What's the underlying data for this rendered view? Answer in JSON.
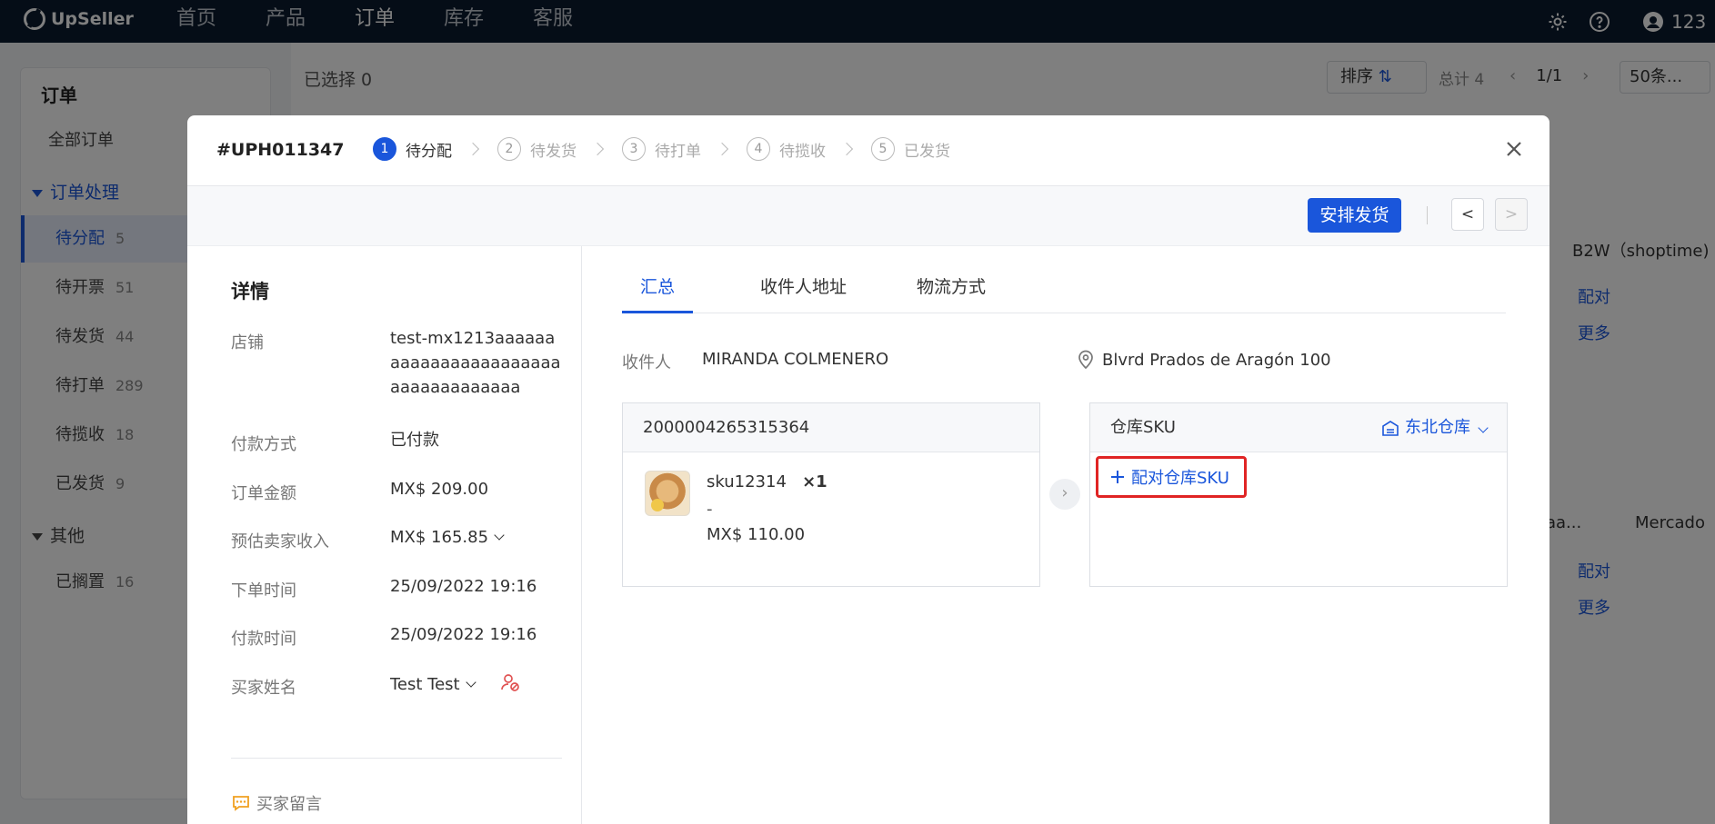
{
  "topbar": {
    "brand": "UpSeller",
    "nav": [
      "首页",
      "产品",
      "订单",
      "库存",
      "客服"
    ],
    "active_nav": "订单",
    "user": "123"
  },
  "sidebar": {
    "title": "订单",
    "all_orders": "全部订单",
    "group_processing": "订单处理",
    "items": [
      {
        "label": "待分配",
        "count": "5"
      },
      {
        "label": "待开票",
        "count": "51"
      },
      {
        "label": "待发货",
        "count": "44"
      },
      {
        "label": "待打单",
        "count": "289"
      },
      {
        "label": "待揽收",
        "count": "18"
      },
      {
        "label": "已发货",
        "count": "9"
      }
    ],
    "group_other": "其他",
    "other_items": [
      {
        "label": "已搁置",
        "count": "16"
      }
    ]
  },
  "list": {
    "selected": "已选择 0",
    "sort": "排序",
    "total": "总计 4",
    "page": "1/1",
    "per_page": "50条...",
    "col_platform": "B2W（shoptime)",
    "row1_pair": "配对",
    "row1_more": "更多",
    "row2_store": "aa...",
    "row2_platform": "Mercado",
    "row2_pair": "配对",
    "row2_more": "更多"
  },
  "modal": {
    "order_no": "#UPH011347",
    "steps": [
      {
        "num": "1",
        "label": "待分配"
      },
      {
        "num": "2",
        "label": "待发货"
      },
      {
        "num": "3",
        "label": "待打单"
      },
      {
        "num": "4",
        "label": "待揽收"
      },
      {
        "num": "5",
        "label": "已发货"
      }
    ],
    "arrange_btn": "安排发货",
    "prev": "<",
    "next": ">",
    "details": {
      "title": "详情",
      "store_label": "店铺",
      "store_value": "test-mx1213aaaaaaaaaaaaaaaaaaaaaaaaaaaaaaaaaaaa",
      "payment_label": "付款方式",
      "payment_value": "已付款",
      "amount_label": "订单金额",
      "amount_value": "MX$ 209.00",
      "income_label": "预估卖家收入",
      "income_value": "MX$ 165.85",
      "order_time_label": "下单时间",
      "order_time_value": "25/09/2022 19:16",
      "pay_time_label": "付款时间",
      "pay_time_value": "25/09/2022 19:16",
      "buyer_label": "买家姓名",
      "buyer_value": "Test Test",
      "buyer_message": "买家留言"
    },
    "tabs": [
      "汇总",
      "收件人地址",
      "物流方式"
    ],
    "recipient_label": "收件人",
    "recipient_name": "MIRANDA COLMENERO",
    "address": "Blvrd Prados de Aragón 100",
    "item_card": {
      "id": "2000004265315364",
      "sku": "sku12314",
      "qty": "×1",
      "dash": "-",
      "price": "MX$ 110.00"
    },
    "warehouse_card": {
      "title": "仓库SKU",
      "warehouse": "东北仓库",
      "pair_btn": "配对仓库SKU"
    }
  },
  "colors": {
    "topbar": "#0b1a2e",
    "primary": "#1a56db",
    "highlight": "#e02424"
  }
}
